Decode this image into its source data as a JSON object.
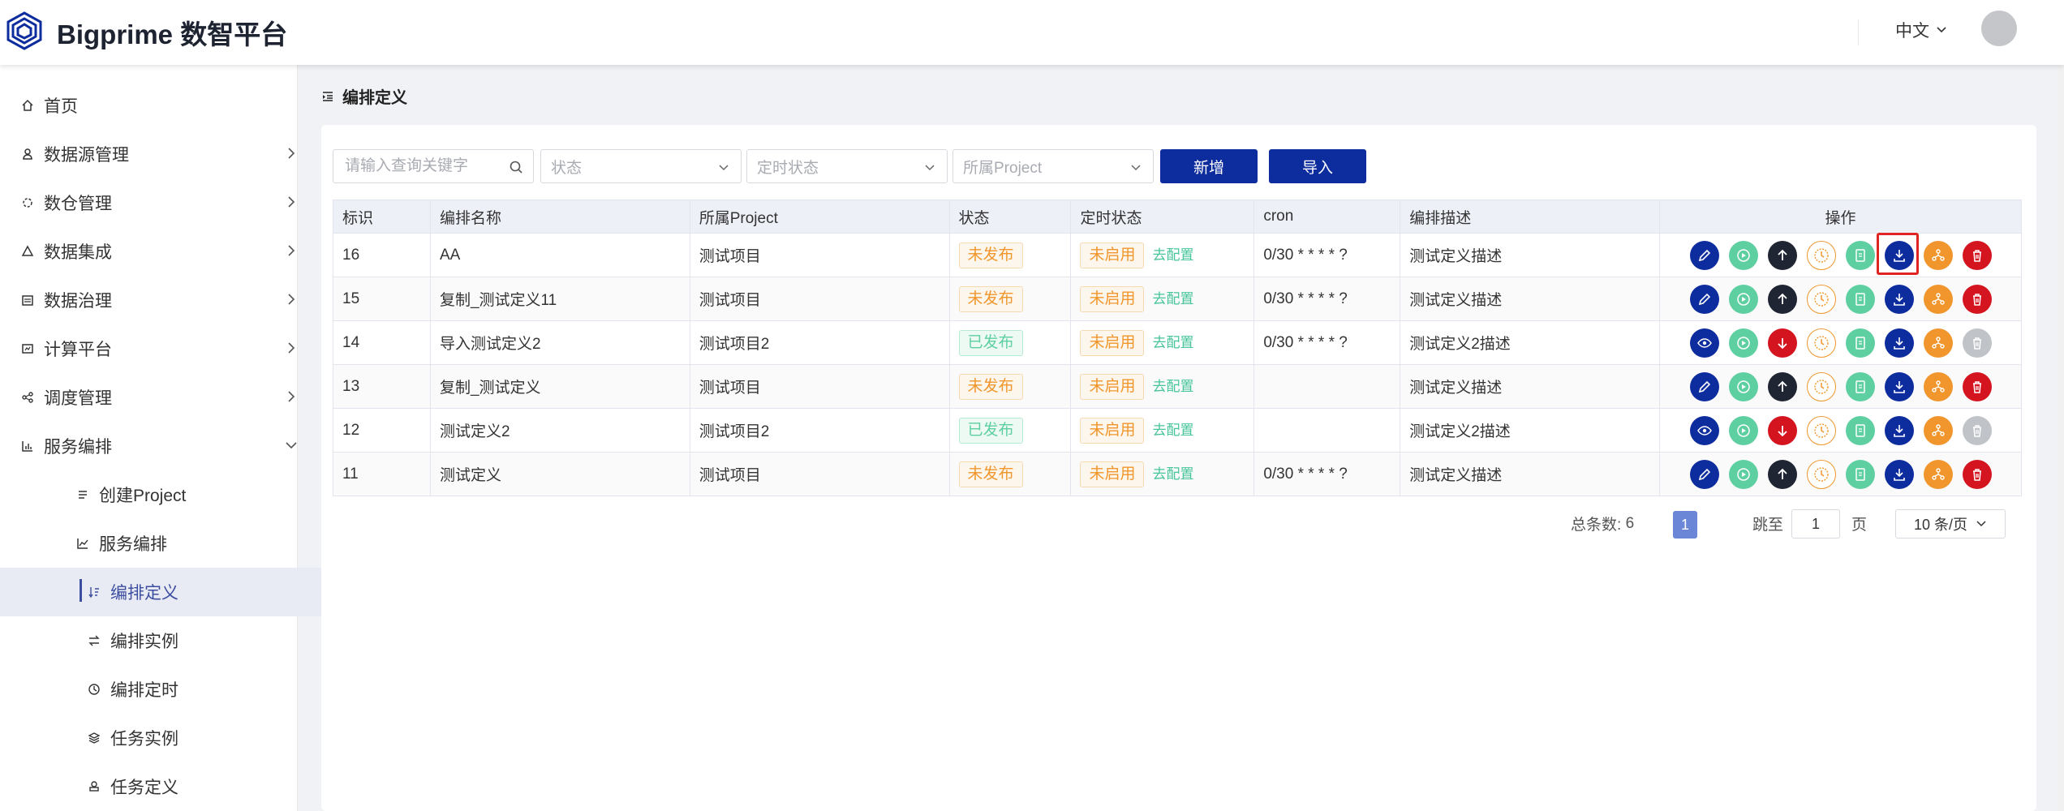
{
  "app": {
    "title": "Bigprime 数智平台",
    "language": "中文"
  },
  "sidebar": {
    "items": [
      {
        "label": "首页",
        "icon": "home-icon"
      },
      {
        "label": "数据源管理",
        "icon": "datasource-icon"
      },
      {
        "label": "数仓管理",
        "icon": "warehouse-icon"
      },
      {
        "label": "数据集成",
        "icon": "integration-icon"
      },
      {
        "label": "数据治理",
        "icon": "governance-icon"
      },
      {
        "label": "计算平台",
        "icon": "compute-icon"
      },
      {
        "label": "调度管理",
        "icon": "schedule-icon"
      },
      {
        "label": "服务编排",
        "icon": "chart-icon"
      },
      {
        "label": "创建Project",
        "icon": "list-icon"
      },
      {
        "label": "服务编排",
        "icon": "line-chart-icon"
      },
      {
        "label": "编排定义",
        "icon": "sort-icon"
      },
      {
        "label": "编排实例",
        "icon": "swap-icon"
      },
      {
        "label": "编排定时",
        "icon": "clock-icon"
      },
      {
        "label": "任务实例",
        "icon": "layers-icon"
      },
      {
        "label": "任务定义",
        "icon": "stamp-icon"
      }
    ]
  },
  "page": {
    "title": "编排定义"
  },
  "filters": {
    "search_placeholder": "请输入查询关键字",
    "status_placeholder": "状态",
    "timer_status_placeholder": "定时状态",
    "project_placeholder": "所属Project",
    "add_label": "新增",
    "import_label": "导入"
  },
  "table": {
    "columns": [
      "标识",
      "编排名称",
      "所属Project",
      "状态",
      "定时状态",
      "cron",
      "编排描述",
      "操作"
    ],
    "config_label": "去配置",
    "rows": [
      {
        "id": "16",
        "name": "AA",
        "project": "测试项目",
        "status": "未发布",
        "status_type": "warn",
        "timer": "未启用",
        "cron": "0/30 * * * * ?",
        "desc": "测试定义描述",
        "published": false
      },
      {
        "id": "15",
        "name": "复制_测试定义11",
        "project": "测试项目",
        "status": "未发布",
        "status_type": "warn",
        "timer": "未启用",
        "cron": "0/30 * * * * ?",
        "desc": "测试定义描述",
        "published": false
      },
      {
        "id": "14",
        "name": "导入测试定义2",
        "project": "测试项目2",
        "status": "已发布",
        "status_type": "ok",
        "timer": "未启用",
        "cron": "0/30 * * * * ?",
        "desc": "测试定义2描述",
        "published": true
      },
      {
        "id": "13",
        "name": "复制_测试定义",
        "project": "测试项目",
        "status": "未发布",
        "status_type": "warn",
        "timer": "未启用",
        "cron": "",
        "desc": "测试定义描述",
        "published": false
      },
      {
        "id": "12",
        "name": "测试定义2",
        "project": "测试项目2",
        "status": "已发布",
        "status_type": "ok",
        "timer": "未启用",
        "cron": "",
        "desc": "测试定义2描述",
        "published": true
      },
      {
        "id": "11",
        "name": "测试定义",
        "project": "测试项目",
        "status": "未发布",
        "status_type": "warn",
        "timer": "未启用",
        "cron": "0/30 * * * * ?",
        "desc": "测试定义描述",
        "published": false
      }
    ]
  },
  "pagination": {
    "total_label": "总条数:",
    "total": "6",
    "current_page": "1",
    "jump_label": "跳至",
    "jump_value": "1",
    "page_suffix": "页",
    "page_size": "10 条/页"
  },
  "colors": {
    "primary": "#0d2c9e",
    "green": "#5ecfa1",
    "dark": "#1f2533",
    "red": "#d4141e",
    "orange": "#f0962c",
    "gray": "#c0c3c8"
  }
}
